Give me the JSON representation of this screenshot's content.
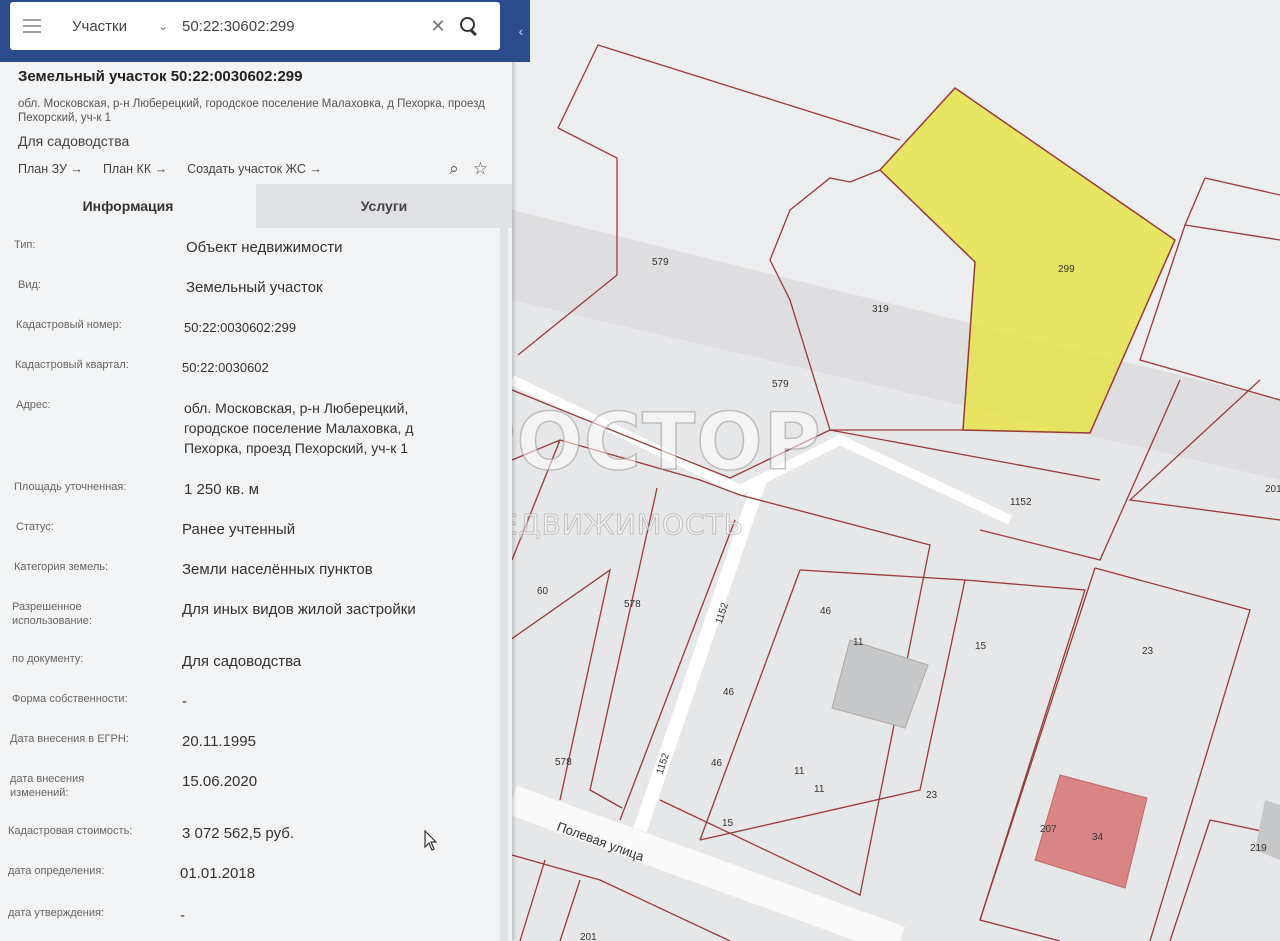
{
  "search": {
    "layer": "Участки",
    "query": "50:22:30602:299"
  },
  "object": {
    "title": "Земельный участок 50:22:0030602:299",
    "address": "обл. Московская, р-н Люберецкий, городское поселение Малаховка, д Пехорка, проезд Пехорский, уч-к 1",
    "use": "Для садоводства",
    "links": [
      "План ЗУ →",
      "План КК →",
      "Создать участок ЖС →"
    ]
  },
  "tabs": [
    "Информация",
    "Услуги"
  ],
  "info": [
    {
      "label": "Тип:",
      "value": "Объект недвижимости"
    },
    {
      "label": "Вид:",
      "value": "Земельный участок"
    },
    {
      "label": "Кадастровый номер:",
      "value": "50:22:0030602:299"
    },
    {
      "label": "Кадастровый квартал:",
      "value": "50:22:0030602"
    },
    {
      "label": "Адрес:",
      "value": "обл. Московская, р-н Люберецкий, городское поселение Малаховка, д Пехорка, проезд Пехорский, уч-к 1"
    },
    {
      "label": "Площадь уточненная:",
      "value": "1 250 кв. м"
    },
    {
      "label": "Статус:",
      "value": "Ранее учтенный"
    },
    {
      "label": "Категория земель:",
      "value": "Земли населённых пунктов"
    },
    {
      "label": "Разрешенное использование:",
      "value": "Для иных видов жилой застройки"
    },
    {
      "label": "по документу:",
      "value": "Для садоводства"
    },
    {
      "label": "Форма собственности:",
      "value": "-"
    },
    {
      "label": "Дата внесения в ЕГРН:",
      "value": "20.11.1995"
    },
    {
      "label": "дата внесения изменений:",
      "value": "15.06.2020"
    },
    {
      "label": "Кадастровая стоимость:",
      "value": "3 072 562,5 руб."
    },
    {
      "label": "дата определения:",
      "value": "01.01.2018"
    },
    {
      "label": "дата утверждения:",
      "value": "-"
    }
  ],
  "watermark": {
    "title": "ПРОСТОР",
    "subtitle": "НЕДВИЖИМОСТЬ"
  },
  "map": {
    "street": "Полевая улица",
    "parcel_labels": [
      "299",
      "579",
      "319",
      "579",
      "1152",
      "1152",
      "1152",
      "60",
      "578",
      "578",
      "46",
      "46",
      "46",
      "11",
      "11",
      "11",
      "15",
      "15",
      "23",
      "23",
      "207",
      "34",
      "219",
      "201"
    ],
    "highlight_color": "#e8e34a",
    "building_color": "#d98585",
    "boundary_color": "#9a3a3a"
  }
}
